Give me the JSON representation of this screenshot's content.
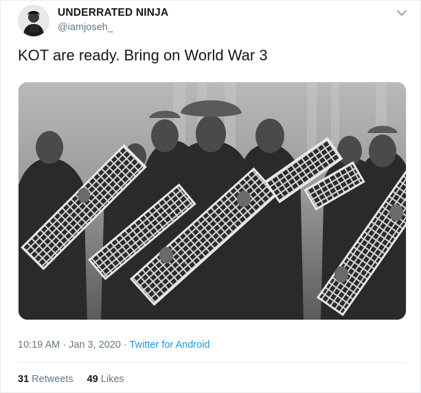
{
  "tweet": {
    "display_name": "UNDERRATED NINJA",
    "handle": "@iamjoseh_",
    "text": "KOT are ready. Bring on World War 3",
    "timestamp": "10:19 AM · Jan 3, 2020",
    "separator": "·",
    "source": "Twitter for Android",
    "retweets": {
      "count": "31",
      "label": "Retweets"
    },
    "likes": {
      "count": "49",
      "label": "Likes"
    }
  },
  "icons": {
    "menu": "chevron-down-icon"
  },
  "colors": {
    "text": "#14171a",
    "secondary": "#657786",
    "link": "#1b95e0",
    "border": "#e6ecf0"
  }
}
